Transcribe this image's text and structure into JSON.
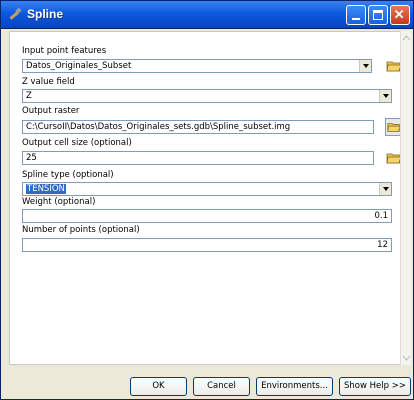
{
  "window": {
    "title": "Spline"
  },
  "fields": {
    "input_label": "Input point features",
    "input_value": "Datos_Originales_Subset",
    "z_label": "Z value field",
    "z_value": "Z",
    "raster_label": "Output raster",
    "raster_value": "C:\\CursoII\\Datos\\Datos_Originales_sets.gdb\\Spline_subset.img",
    "cell_label": "Output cell size (optional)",
    "cell_value": "25",
    "spline_label": "Spline type (optional)",
    "spline_value": "TENSION",
    "weight_label": "Weight (optional)",
    "weight_value": "0.1",
    "points_label": "Number of points (optional)",
    "points_value": "12"
  },
  "buttons": {
    "ok": "OK",
    "cancel": "Cancel",
    "environments": "Environments...",
    "show_help": "Show Help >>"
  }
}
